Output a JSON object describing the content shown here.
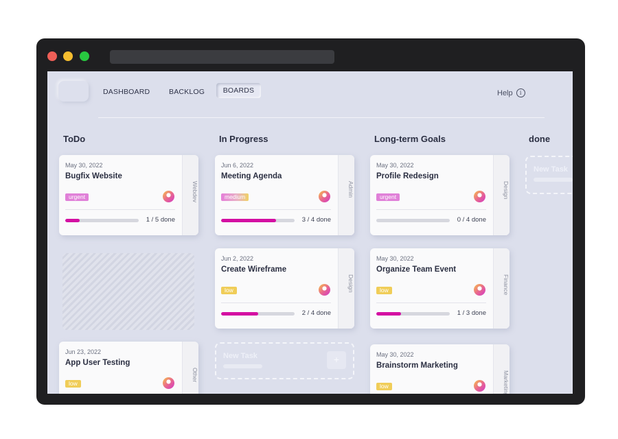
{
  "nav": {
    "items": [
      "DASHBOARD",
      "BACKLOG",
      "BOARDS"
    ],
    "active": "BOARDS",
    "help": "Help",
    "help_icon": "info-icon"
  },
  "columns": [
    {
      "title": "ToDo"
    },
    {
      "title": "In Progress"
    },
    {
      "title": "Long-term Goals"
    },
    {
      "title": "done"
    }
  ],
  "cards": [
    {
      "date": "May 30, 2022",
      "title": "Bugfix Website",
      "tag": "urgent",
      "category": "Webdev",
      "done": 1,
      "total": 5,
      "progress_text": "1 / 5 done"
    },
    {
      "date": "Jun 23, 2022",
      "title": "App User Testing",
      "tag": "low",
      "category": "Other"
    },
    {
      "date": "Jun 6, 2022",
      "title": "Meeting Agenda",
      "tag": "medium",
      "category": "Admin",
      "done": 3,
      "total": 4,
      "progress_text": "3 / 4 done"
    },
    {
      "date": "Jun 2, 2022",
      "title": "Create Wireframe",
      "tag": "low",
      "category": "Design",
      "done": 2,
      "total": 4,
      "progress_text": "2 / 4 done"
    },
    {
      "date": "May 30, 2022",
      "title": "Profile Redesign",
      "tag": "urgent",
      "category": "Design",
      "done": 0,
      "total": 4,
      "progress_text": "0 / 4 done"
    },
    {
      "date": "May 30, 2022",
      "title": "Organize Team Event",
      "tag": "low",
      "category": "Finance",
      "done": 1,
      "total": 3,
      "progress_text": "1 / 3 done"
    },
    {
      "date": "May 30, 2022",
      "title": "Brainstorm Marketing",
      "tag": "low",
      "category": "Marketing"
    }
  ],
  "new_task": {
    "label": "New Task",
    "plus": "+"
  },
  "colors": {
    "accent": "#d40fa2",
    "urgent": "#e080d8",
    "low": "#f0cd58",
    "board_bg": "#dcdfec"
  }
}
